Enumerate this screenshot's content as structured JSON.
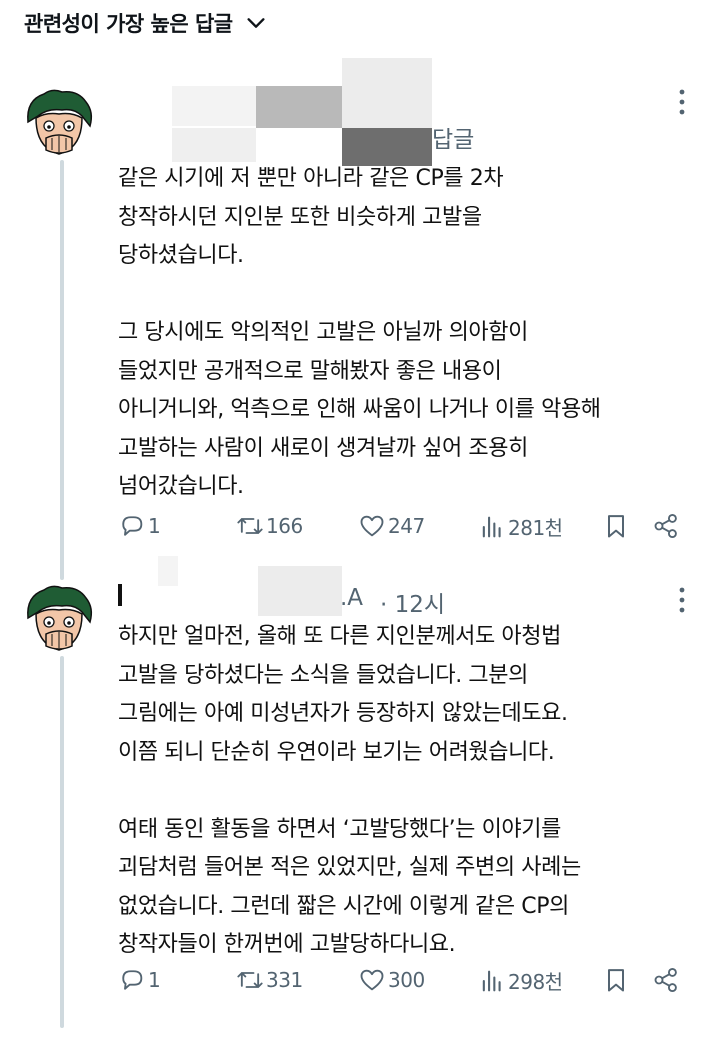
{
  "header": {
    "sort_label": "관련성이 가장 높은 답글"
  },
  "replies": [
    {
      "author_suffix": "",
      "reply_label": "답글",
      "meta": "",
      "body": "같은 시기에 저 뿐만 아니라 같은 CP를 2차\n창작하시던 지인분 또한 비슷하게 고발을\n당하셨습니다.\n\n그 당시에도 악의적인 고발은 아닐까 의아함이\n들었지만 공개적으로 말해봤자 좋은 내용이\n아니거니와, 억측으로 인해 싸움이 나거나 이를 악용해\n고발하는 사람이 새로이 생겨날까 싶어 조용히\n넘어갔습니다.",
      "actions": {
        "replies": "1",
        "retweets": "166",
        "likes": "247",
        "views": "281천"
      }
    },
    {
      "author_suffix": ".A",
      "meta": "· 12시",
      "body": "하지만 얼마전, 올해 또 다른 지인분께서도 아청법\n고발을 당하셨다는 소식을 들었습니다. 그분의\n그림에는 아예 미성년자가 등장하지 않았는데도요.\n이쯤 되니 단순히 우연이라 보기는 어려웠습니다.\n\n여태 동인 활동을 하면서 ‘고발당했다’는 이야기를\n괴담처럼 들어본 적은 있었지만, 실제 주변의 사례는\n없었습니다. 그런데 짧은 시간에 이렇게 같은 CP의\n창작자들이 한꺼번에 고발당하다니요.",
      "actions": {
        "replies": "1",
        "retweets": "331",
        "likes": "300",
        "views": "298천"
      }
    }
  ],
  "colors": {
    "text": "#0f1419",
    "muted": "#536471",
    "thread": "#cfd9de",
    "avatar_hair": "#1f5c34",
    "avatar_skin": "#f2c6a8"
  },
  "icons": [
    "chevron-down-icon",
    "more-icon",
    "reply-icon",
    "retweet-icon",
    "like-icon",
    "views-icon",
    "bookmark-icon",
    "share-icon"
  ]
}
